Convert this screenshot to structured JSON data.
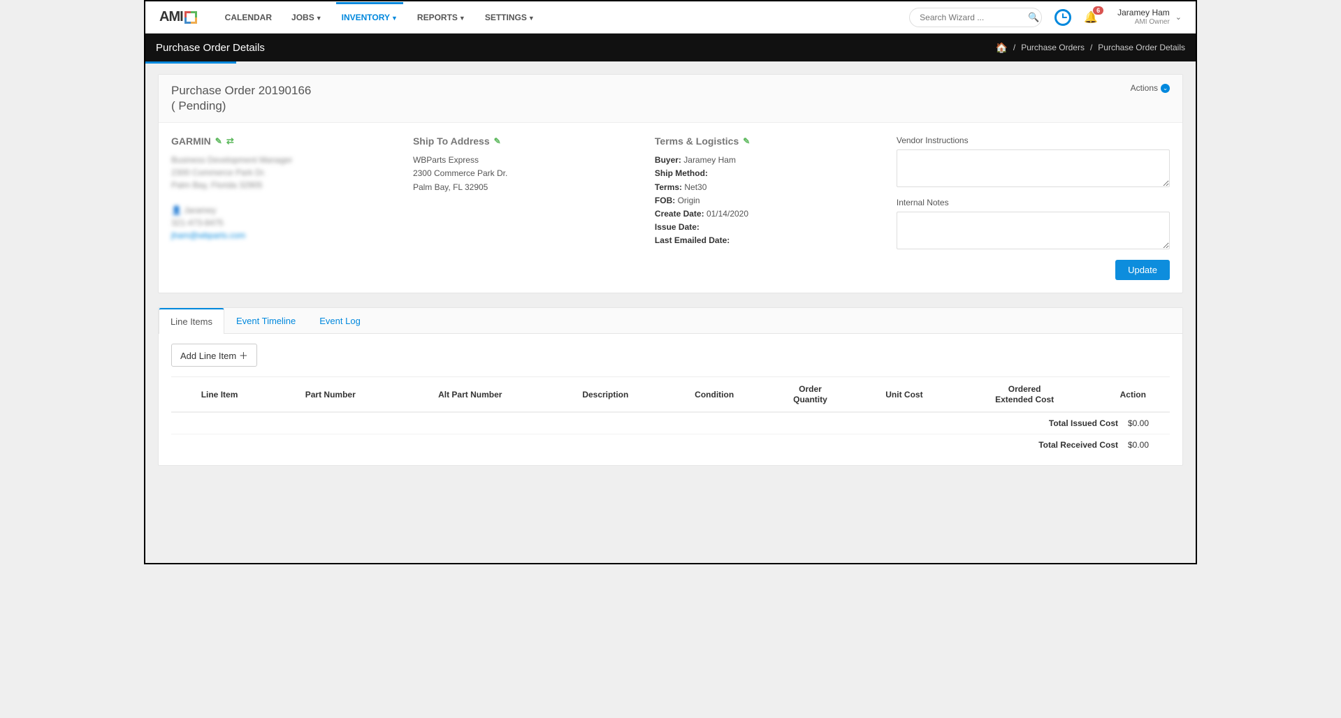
{
  "nav": {
    "logo": "AMI",
    "items": [
      "CALENDAR",
      "JOBS",
      "INVENTORY",
      "REPORTS",
      "SETTINGS"
    ],
    "active_index": 2,
    "search_placeholder": "Search Wizard ...",
    "notification_count": "6",
    "user_name": "Jaramey Ham",
    "user_role": "AMI Owner"
  },
  "titlebar": {
    "page_title": "Purchase Order Details",
    "crumb1": "Purchase Orders",
    "crumb2": "Purchase Order Details"
  },
  "header": {
    "po_line1": "Purchase Order 20190166",
    "po_line2": "( Pending)",
    "actions_label": "Actions"
  },
  "vendor": {
    "heading": "GARMIN",
    "line1": "Business Development Manager",
    "line2": "2300 Commerce Park Dr.",
    "line3": "Palm Bay, Florida 32905",
    "contact_name": "Jaramey",
    "contact_phone": "321-473-8475",
    "contact_email": "jham@wbparts.com"
  },
  "shipto": {
    "heading": "Ship To Address",
    "line1": "WBParts Express",
    "line2": "2300 Commerce Park Dr.",
    "line3": "Palm Bay, FL 32905"
  },
  "terms": {
    "heading": "Terms & Logistics",
    "buyer_label": "Buyer:",
    "buyer_value": "Jaramey Ham",
    "ship_method_label": "Ship Method:",
    "ship_method_value": "",
    "terms_label": "Terms:",
    "terms_value": "Net30",
    "fob_label": "FOB:",
    "fob_value": "Origin",
    "create_date_label": "Create Date:",
    "create_date_value": "01/14/2020",
    "issue_date_label": "Issue Date:",
    "issue_date_value": "",
    "last_emailed_label": "Last Emailed Date:",
    "last_emailed_value": ""
  },
  "notes": {
    "vendor_instructions_label": "Vendor Instructions",
    "internal_notes_label": "Internal Notes",
    "update_button": "Update"
  },
  "tabs": {
    "items": [
      "Line Items",
      "Event Timeline",
      "Event Log"
    ],
    "active_index": 0,
    "add_line_item": "Add Line Item",
    "columns": {
      "line_item": "Line Item",
      "part_number": "Part Number",
      "alt_part_number": "Alt Part Number",
      "description": "Description",
      "condition": "Condition",
      "order_qty_l1": "Order",
      "order_qty_l2": "Quantity",
      "unit_cost": "Unit Cost",
      "ext_cost_l1": "Ordered",
      "ext_cost_l2": "Extended Cost",
      "action": "Action"
    },
    "totals": {
      "issued_label": "Total Issued Cost",
      "issued_value": "$0.00",
      "received_label": "Total Received Cost",
      "received_value": "$0.00"
    }
  }
}
